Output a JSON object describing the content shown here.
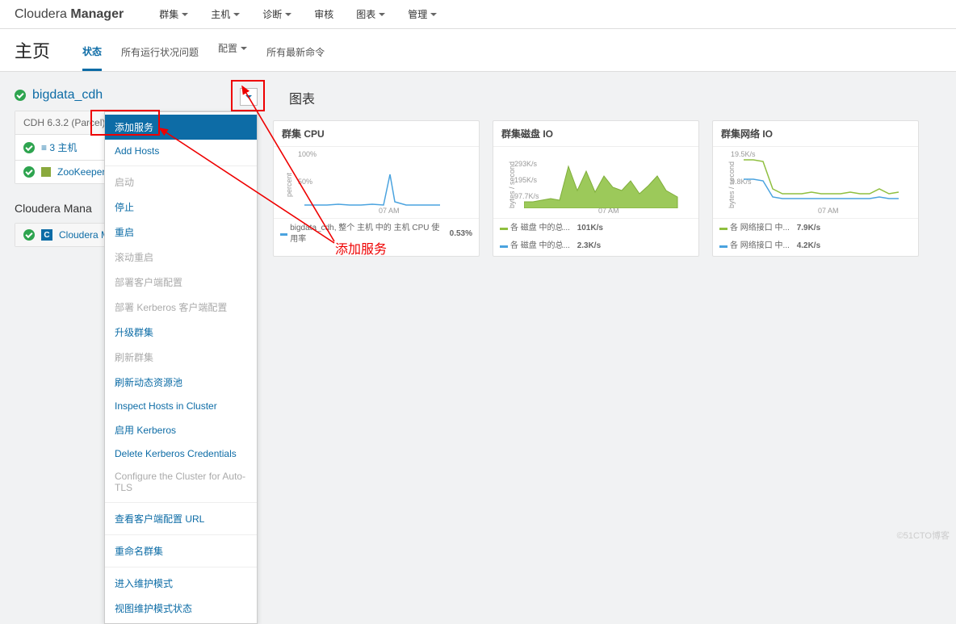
{
  "brand": {
    "light": "Cloudera",
    "bold": "Manager"
  },
  "topnav": [
    "群集",
    "主机",
    "诊断",
    "审核",
    "图表",
    "管理"
  ],
  "page_title": "主页",
  "tabs": [
    "状态",
    "所有运行状况问题",
    "配置",
    "所有最新命令"
  ],
  "cluster": {
    "name": "bigdata_cdh",
    "version_row": "CDH 6.3.2 (Parcel)",
    "hosts_row": "≡ 3 主机",
    "zk_row": "ZooKeeper"
  },
  "cm_section_title": "Cloudera Mana",
  "cm_row": "Cloudera M",
  "dropdown": {
    "add_service": "添加服务",
    "add_hosts": "Add Hosts",
    "start": "启动",
    "stop": "停止",
    "restart": "重启",
    "rolling_restart": "滚动重启",
    "deploy_client": "部署客户端配置",
    "deploy_krb_client": "部署 Kerberos 客户端配置",
    "upgrade": "升级群集",
    "refresh": "刷新群集",
    "refresh_pool": "刷新动态资源池",
    "inspect": "Inspect Hosts in Cluster",
    "enable_krb": "启用 Kerberos",
    "delete_krb": "Delete Kerberos Credentials",
    "auto_tls": "Configure the Cluster for Auto-TLS",
    "view_client_url": "查看客户端配置 URL",
    "rename": "重命名群集",
    "enter_maint": "进入维护模式",
    "view_maint": "视图维护模式状态"
  },
  "charts_header": "图表",
  "annotation": "添加服务",
  "watermark": "©51CTO博客",
  "chart_data": [
    {
      "type": "line",
      "title": "群集 CPU",
      "ylabel": "percent",
      "ylim": [
        0,
        100
      ],
      "yticks": [
        "100%",
        "50%"
      ],
      "xtick": "07 AM",
      "series": [
        {
          "name": "bigdata_cdh, 整个 主机 中的 主机 CPU 使用率",
          "value_label": "0.53%",
          "color": "#4aa3df",
          "values": [
            2,
            2,
            2,
            3,
            2,
            2,
            3,
            2,
            40,
            5,
            2,
            2,
            2,
            2
          ]
        }
      ]
    },
    {
      "type": "area",
      "title": "群集磁盘 IO",
      "ylabel": "bytes / second",
      "ylim": [
        0,
        320000
      ],
      "yticks": [
        "293K/s",
        "195K/s",
        "97.7K/s"
      ],
      "xtick": "07 AM",
      "series": [
        {
          "name": "各 磁盘 中的总...",
          "value_label": "101K/s",
          "color": "#8fbf3f",
          "values": [
            40,
            40,
            50,
            60,
            50,
            260,
            120,
            230,
            110,
            200,
            140,
            120,
            180,
            110,
            160,
            200,
            120,
            80
          ]
        },
        {
          "name": "各 磁盘 中的总...",
          "value_label": "2.3K/s",
          "color": "#4aa3df",
          "values": [
            2,
            2,
            2,
            2,
            2,
            2,
            2,
            2,
            2,
            2,
            2,
            2,
            2,
            2,
            2,
            2,
            2,
            2
          ]
        }
      ]
    },
    {
      "type": "line",
      "title": "群集网络 IO",
      "ylabel": "bytes / second",
      "ylim": [
        0,
        20000
      ],
      "yticks": [
        "19.5K/s",
        "9.8K/s"
      ],
      "xtick": "07 AM",
      "series": [
        {
          "name": "各 网络接口 中...",
          "value_label": "7.9K/s",
          "color": "#8fbf3f",
          "values": [
            18,
            18,
            17,
            7,
            5,
            5,
            5,
            6,
            5,
            5,
            5,
            6,
            5,
            5,
            7,
            5,
            6
          ]
        },
        {
          "name": "各 网络接口 中...",
          "value_label": "4.2K/s",
          "color": "#4aa3df",
          "values": [
            11,
            11,
            10,
            4,
            3,
            3,
            3,
            3,
            3,
            3,
            3,
            3,
            3,
            3,
            4,
            3,
            3
          ]
        }
      ]
    }
  ]
}
